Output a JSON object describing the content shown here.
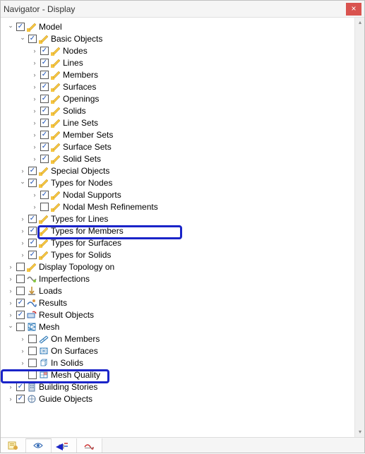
{
  "window": {
    "title": "Navigator - Display",
    "close_label": "×"
  },
  "tree": {
    "model": {
      "label": "Model",
      "basic_objects": {
        "label": "Basic Objects",
        "nodes": "Nodes",
        "lines": "Lines",
        "members": "Members",
        "surfaces": "Surfaces",
        "openings": "Openings",
        "solids": "Solids",
        "line_sets": "Line Sets",
        "member_sets": "Member Sets",
        "surface_sets": "Surface Sets",
        "solid_sets": "Solid Sets"
      },
      "special_objects": "Special Objects",
      "types_for_nodes": {
        "label": "Types for Nodes",
        "nodal_supports": "Nodal Supports",
        "nodal_mesh_refinements": "Nodal Mesh Refinements"
      },
      "types_for_lines": "Types for Lines",
      "types_for_members": "Types for Members",
      "types_for_surfaces": "Types for Surfaces",
      "types_for_solids": "Types for Solids"
    },
    "display_topology_on": "Display Topology on",
    "imperfections": "Imperfections",
    "loads": "Loads",
    "results": "Results",
    "result_objects": "Result Objects",
    "mesh": {
      "label": "Mesh",
      "on_members": "On Members",
      "on_surfaces": "On Surfaces",
      "in_solids": "In Solids",
      "mesh_quality": "Mesh Quality"
    },
    "building_stories": "Building Stories",
    "guide_objects": "Guide Objects"
  }
}
